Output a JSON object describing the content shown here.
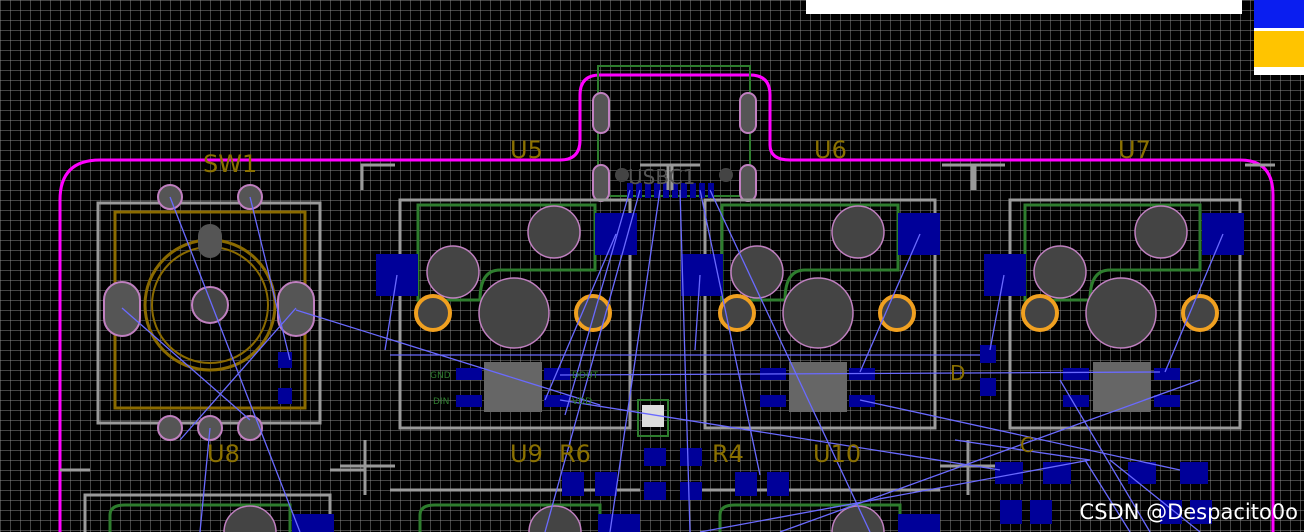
{
  "designators": {
    "sw1": "SW1",
    "u5": "U5",
    "u6": "U6",
    "u7": "U7",
    "u8": "U8",
    "u9": "U9",
    "u10": "U10",
    "r6": "R6",
    "r4": "R4",
    "usb": "USBC1",
    "c": "C",
    "d": "D"
  },
  "pin_labels": {
    "gnd": "GND",
    "din": "DIN",
    "dout": "DOUT",
    "vdd": "VDD"
  },
  "watermark": "CSDN @Despacito0o",
  "colors": {
    "background": "#000000",
    "grid": "#969696",
    "board_outline": "#ff00ff",
    "silkscreen": "#9a9a9a",
    "top_pad": "#000099",
    "ratsnest": "#6a6aff",
    "footprint_outline": "#2e7d2e",
    "encoder_outline": "#8a6a00",
    "via_ring": "#f0a020",
    "layer_blue": "#0a1ef0",
    "layer_yellow": "#ffc400"
  }
}
